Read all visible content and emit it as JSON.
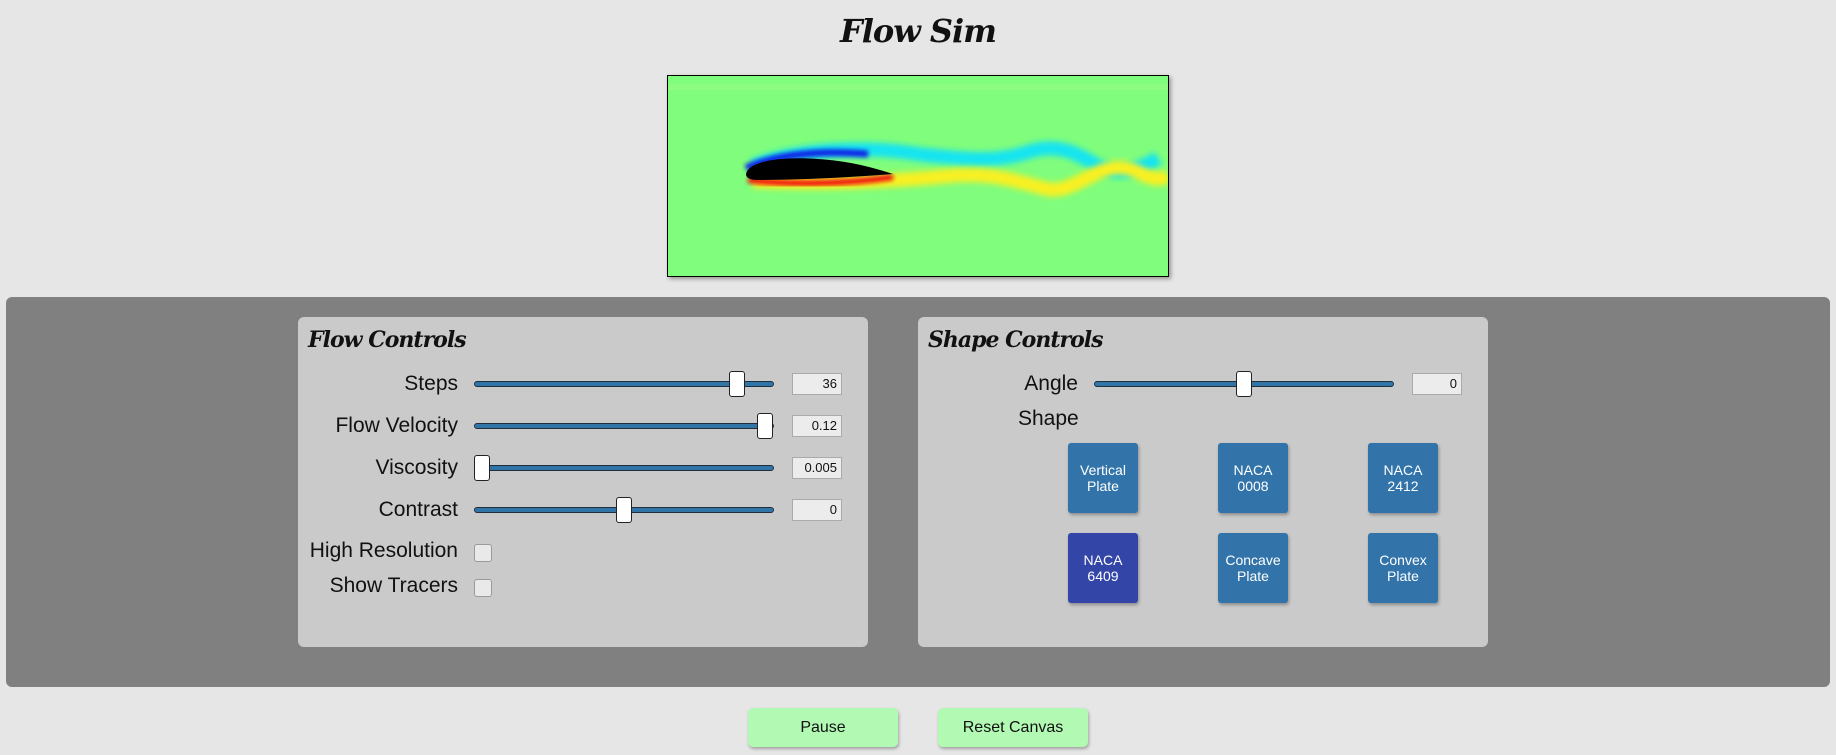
{
  "app": {
    "title": "Flow Sim"
  },
  "flow_controls": {
    "title": "Flow Controls",
    "steps": {
      "label": "Steps",
      "value": "36",
      "fraction": 0.875
    },
    "flow_velocity": {
      "label": "Flow Velocity",
      "value": "0.12",
      "fraction": 0.97
    },
    "viscosity": {
      "label": "Viscosity",
      "value": "0.005",
      "fraction": 0.025
    },
    "contrast": {
      "label": "Contrast",
      "value": "0",
      "fraction": 0.5
    },
    "high_resolution": {
      "label": "High Resolution",
      "checked": false
    },
    "show_tracers": {
      "label": "Show Tracers",
      "checked": false
    }
  },
  "shape_controls": {
    "title": "Shape Controls",
    "angle": {
      "label": "Angle",
      "value": "0",
      "fraction": 0.5
    },
    "shape_label": "Shape",
    "shapes": [
      {
        "label": "Vertical\nPlate",
        "selected": false
      },
      {
        "label": "NACA\n0008",
        "selected": false
      },
      {
        "label": "NACA\n2412",
        "selected": false
      },
      {
        "label": "NACA\n6409",
        "selected": true
      },
      {
        "label": "Concave\nPlate",
        "selected": false
      },
      {
        "label": "Convex\nPlate",
        "selected": false
      }
    ]
  },
  "actions": {
    "pause_label": "Pause",
    "reset_label": "Reset Canvas"
  },
  "colors": {
    "background": "#e6e6e6",
    "controls_area": "#808080",
    "panel": "#cacaca",
    "shape_button": "#3274aa",
    "shape_button_selected": "#3346a8",
    "action_button": "#b2fab4",
    "field_background": "#80fd7c"
  }
}
